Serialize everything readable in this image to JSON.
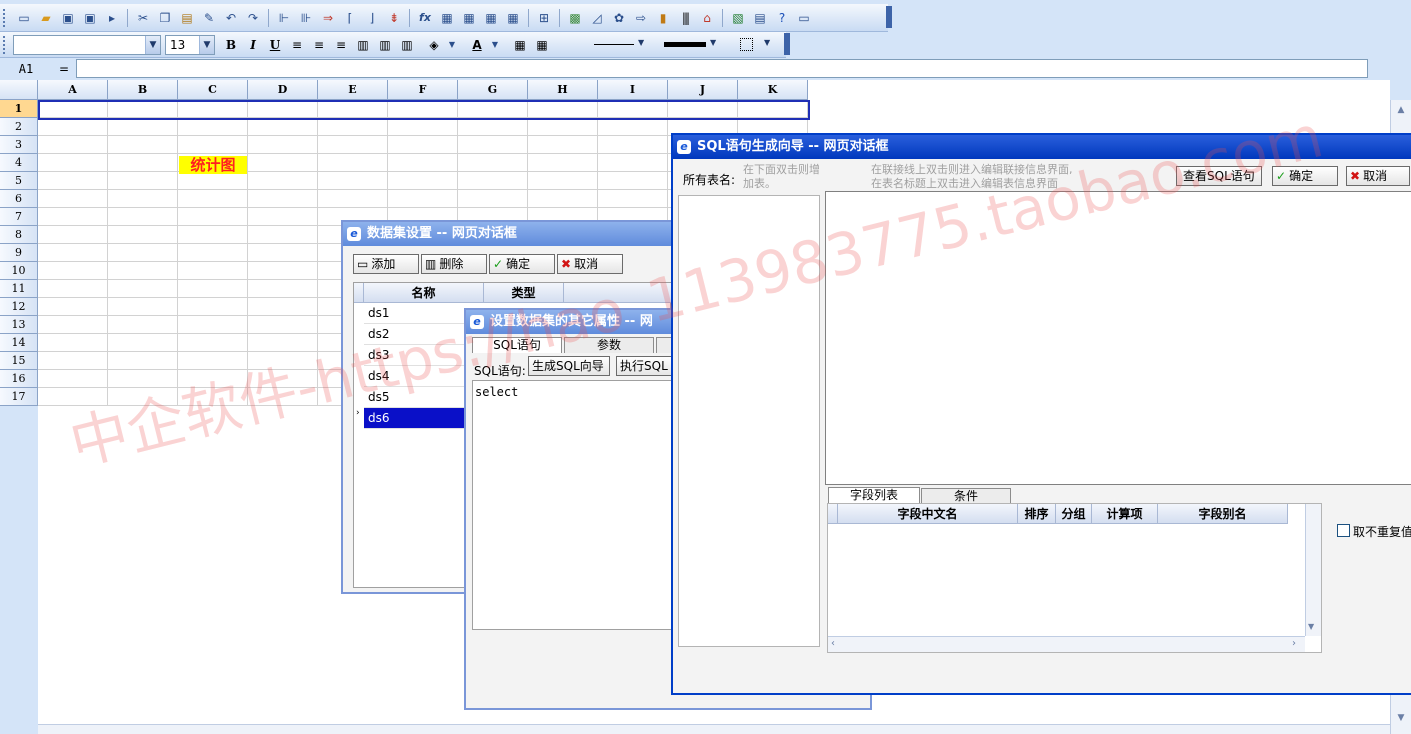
{
  "toolbar1": {
    "icons": [
      "new-file-icon",
      "open-folder-icon",
      "save-icon",
      "save-all-icon",
      "play-icon",
      "cut-icon",
      "copy-icon",
      "paste-icon",
      "format-painter-icon",
      "undo-icon",
      "redo-icon",
      "insert-row-icon",
      "insert-col-icon",
      "delete-row-icon",
      "align-up-icon",
      "align-down-icon",
      "merge-icon",
      "function-icon",
      "table-form-1-icon",
      "table-form-2-icon",
      "table-form-3-icon",
      "table-form-4-icon",
      "dataset-icon",
      "image-icon",
      "chart-icon",
      "gear-icon",
      "export-icon",
      "bar-chart-icon",
      "barcode-icon",
      "home-icon",
      "excel-icon",
      "report-icon",
      "help-icon",
      "about-icon"
    ],
    "function_glyph": "fx"
  },
  "toolbar2": {
    "font_name": "",
    "font_size": "13",
    "bold": "B",
    "italic": "I",
    "underline": "U",
    "text_color_glyph": "A"
  },
  "formula": {
    "cell_ref": "A1",
    "eq": "=",
    "value": ""
  },
  "sheet": {
    "columns": [
      "A",
      "B",
      "C",
      "D",
      "E",
      "F",
      "G",
      "H",
      "I",
      "J",
      "K"
    ],
    "rows": [
      "1",
      "2",
      "3",
      "4",
      "5",
      "6",
      "7",
      "8",
      "9",
      "10",
      "11",
      "12",
      "13",
      "14",
      "15",
      "16",
      "17"
    ],
    "chart_cell_text": "统计图"
  },
  "dialog_dataset": {
    "title": "数据集设置 -- 网页对话框",
    "add_label": "添加",
    "delete_label": "删除",
    "ok_label": "确定",
    "cancel_label": "取消",
    "col_name": "名称",
    "col_type": "类型",
    "rows": [
      "ds1",
      "ds2",
      "ds3",
      "ds4",
      "ds5",
      "ds6"
    ],
    "selected_row": "ds6"
  },
  "dialog_props": {
    "title": "设置数据集的其它属性 -- 网",
    "tab_sql": "SQL语句",
    "tab_params": "参数",
    "sql_label": "SQL语句:",
    "gen_sql_button": "生成SQL向导",
    "exec_sql_button": "执行SQL",
    "sql_text": "select"
  },
  "dialog_wizard": {
    "title": "SQL语句生成向导 -- 网页对话框",
    "all_tables_label": "所有表名:",
    "hint_left": "在下面双击则增加表。",
    "hint_right_1": "在联接线上双击则进入编辑联接信息界面,",
    "hint_right_2": "在表名标题上双击进入编辑表信息界面",
    "view_sql_button": "查看SQL语句",
    "ok_label": "确定",
    "cancel_label": "取消",
    "tab_fields": "字段列表",
    "tab_conditions": "条件",
    "headers": [
      "字段中文名",
      "排序",
      "分组",
      "计算项",
      "字段别名"
    ],
    "distinct_label": "取不重复值"
  },
  "watermarks": {
    "left": "中企软件-https://hao",
    "right": "113983775.taobao.com"
  },
  "colors": {
    "toolbar_bg": "#d4e4f8",
    "dialog_title": "#0038bd",
    "selection": "#0a10c8",
    "chart_cell_bg": "#ffff00",
    "chart_cell_fg": "#ff2020"
  }
}
